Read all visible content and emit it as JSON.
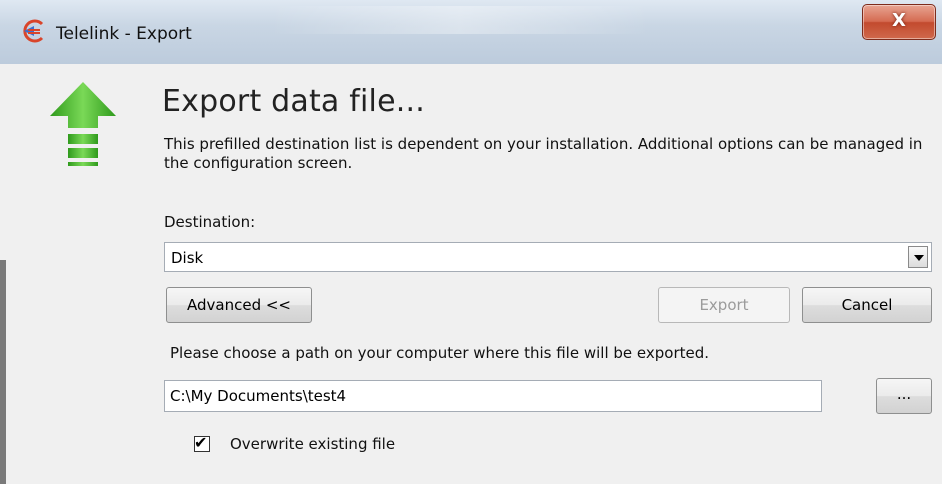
{
  "window": {
    "title": "Telelink - Export",
    "close_symbol": "X"
  },
  "header": {
    "title": "Export data file...",
    "description": "This prefilled destination list is dependent on your installation. Additional options can be managed in the configuration screen."
  },
  "destination": {
    "label": "Destination:",
    "selected": "Disk"
  },
  "buttons": {
    "advanced": "Advanced <<",
    "export": "Export",
    "cancel": "Cancel",
    "browse": "..."
  },
  "path": {
    "hint": "Please choose a path on your computer where this file will be exported.",
    "value": "C:\\My Documents\\test4"
  },
  "overwrite": {
    "label": "Overwrite existing file",
    "checked": true
  },
  "icons": {
    "app": "telelink-app-icon",
    "export": "export-up-arrow-icon"
  },
  "colors": {
    "arrow_green": "#4fbf2f",
    "close_red": "#c94a2e"
  }
}
